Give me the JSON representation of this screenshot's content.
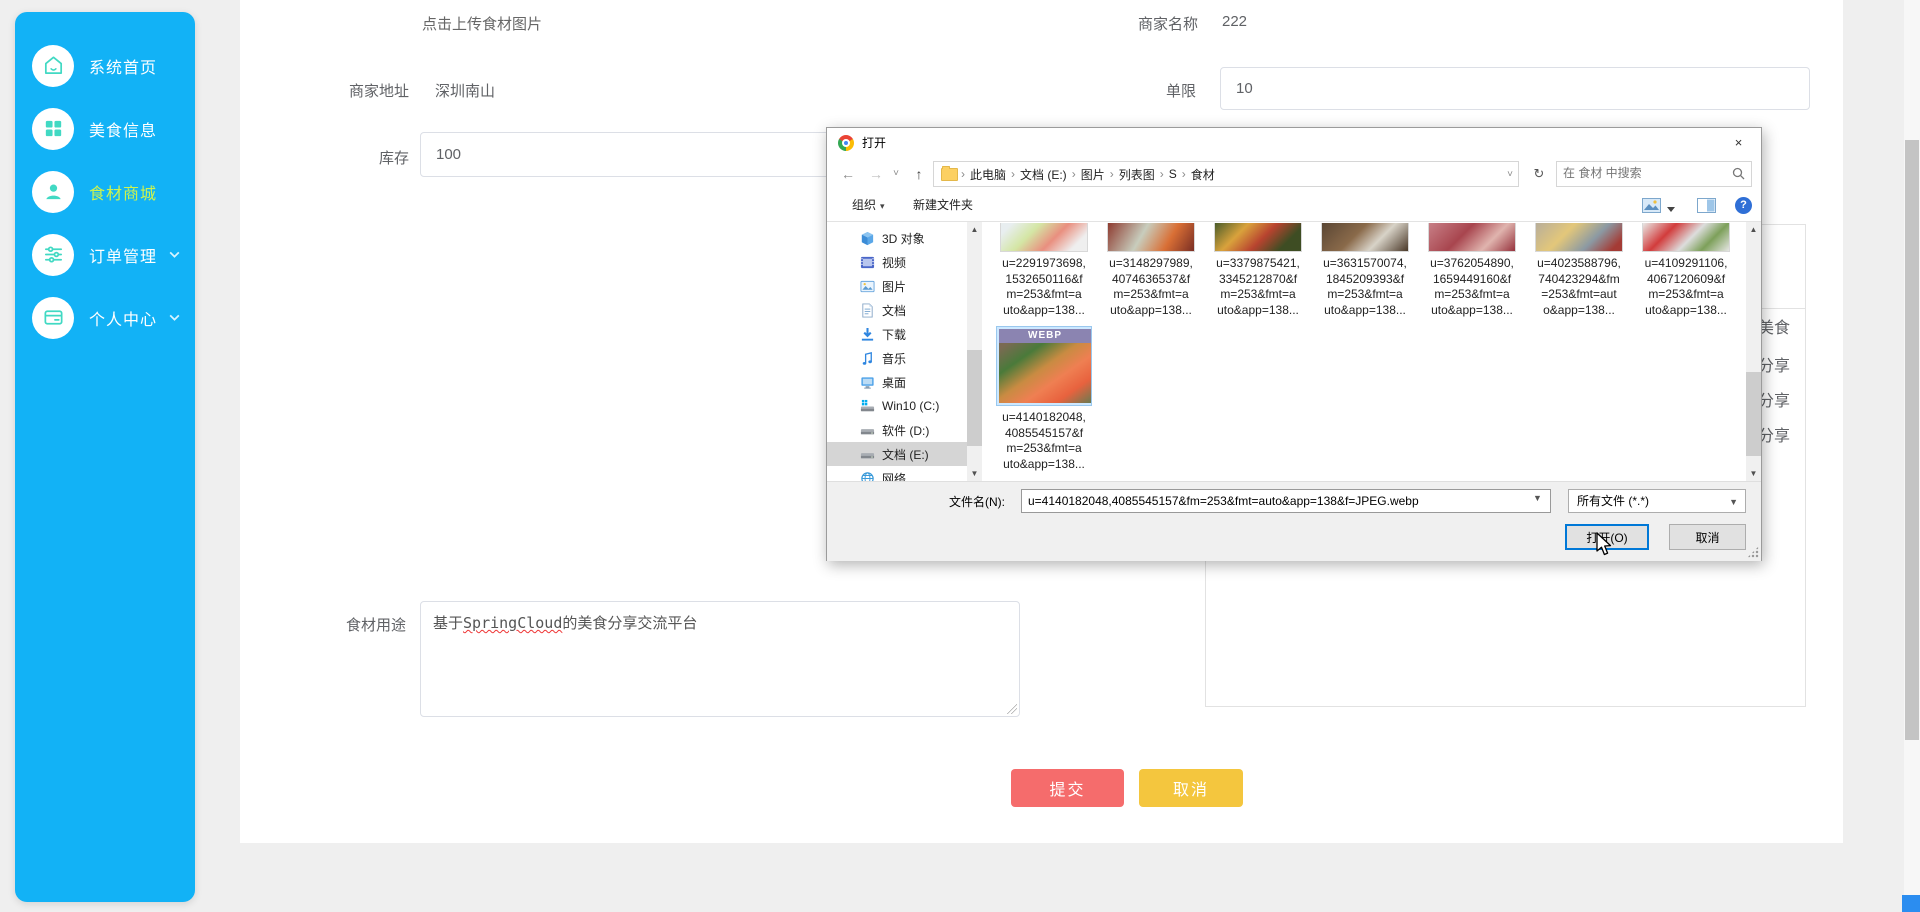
{
  "page": {
    "bg": "#efefef"
  },
  "sidebar": {
    "bg": "#12b2f6",
    "icon_color": "#41d9c3",
    "active_color": "#cdf34f",
    "items": [
      {
        "label": "系统首页",
        "icon": "home",
        "active": false,
        "chevron": false
      },
      {
        "label": "美食信息",
        "icon": "grid",
        "active": false,
        "chevron": false
      },
      {
        "label": "食材商城",
        "icon": "user",
        "active": true,
        "chevron": false
      },
      {
        "label": "订单管理",
        "icon": "sliders",
        "active": false,
        "chevron": true
      },
      {
        "label": "个人中心",
        "icon": "wallet",
        "active": false,
        "chevron": true
      }
    ]
  },
  "form": {
    "upload_hint": "点击上传食材图片",
    "fields": {
      "merchant_name": {
        "label": "商家名称",
        "value": "222"
      },
      "merchant_address": {
        "label": "商家地址",
        "value": "深圳南山"
      },
      "order_limit": {
        "label": "单限",
        "value": "10"
      },
      "stock": {
        "label": "库存",
        "value": "100"
      },
      "usage": {
        "label": "食材用途",
        "value_prefix": "基于",
        "value_misspelled": "SpringCloud",
        "value_suffix": "的美食分享交流平台"
      }
    },
    "right_panel_fragments": [
      "美食",
      "分享",
      "分享",
      "分享"
    ],
    "submit": {
      "label": "提交",
      "color": "#f56c6c"
    },
    "cancel": {
      "label": "取消",
      "color": "#f4c63e"
    }
  },
  "dialog": {
    "title": "打开",
    "close_glyph": "×",
    "nav": {
      "back": "←",
      "forward": "→",
      "dropdown": "˅",
      "up": "↑",
      "refresh": "↻"
    },
    "breadcrumb": [
      "此电脑",
      "文档 (E:)",
      "图片",
      "列表图",
      "S",
      "食材"
    ],
    "search_placeholder": "在 食材 中搜索",
    "toolbar": {
      "organize": "组织",
      "organize_caret": "▾",
      "new_folder": "新建文件夹",
      "help": "?"
    },
    "nav_pane": [
      {
        "label": "3D 对象",
        "icon": "cube"
      },
      {
        "label": "视频",
        "icon": "film"
      },
      {
        "label": "图片",
        "icon": "picture"
      },
      {
        "label": "文档",
        "icon": "doc"
      },
      {
        "label": "下载",
        "icon": "download"
      },
      {
        "label": "音乐",
        "icon": "music"
      },
      {
        "label": "桌面",
        "icon": "desktop"
      },
      {
        "label": "Win10 (C:)",
        "icon": "drive-win"
      },
      {
        "label": "软件 (D:)",
        "icon": "drive"
      },
      {
        "label": "文档 (E:)",
        "icon": "drive",
        "selected": true
      },
      {
        "label": "网络",
        "icon": "network",
        "partial": true
      }
    ],
    "files_row1": [
      {
        "name_lines": [
          "u=2291973698,",
          "1532650116&f",
          "m=253&fmt=a",
          "uto&app=138..."
        ]
      },
      {
        "name_lines": [
          "u=3148297989,",
          "4074636537&f",
          "m=253&fmt=a",
          "uto&app=138..."
        ]
      },
      {
        "name_lines": [
          "u=3379875421,",
          "3345212870&f",
          "m=253&fmt=a",
          "uto&app=138..."
        ]
      },
      {
        "name_lines": [
          "u=3631570074,",
          "1845209393&f",
          "m=253&fmt=a",
          "uto&app=138..."
        ]
      },
      {
        "name_lines": [
          "u=3762054890,",
          "1659449160&f",
          "m=253&fmt=a",
          "uto&app=138..."
        ]
      },
      {
        "name_lines": [
          "u=4023588796,",
          "740423294&fm",
          "=253&fmt=aut",
          "o&app=138..."
        ]
      },
      {
        "name_lines": [
          "u=4109291106,",
          "4067120609&f",
          "m=253&fmt=a",
          "uto&app=138..."
        ]
      }
    ],
    "selected_file": {
      "badge": "WEBP",
      "name_lines": [
        "u=4140182048,",
        "4085545157&f",
        "m=253&fmt=a",
        "uto&app=138..."
      ]
    },
    "filename_label": "文件名(N):",
    "filename_value": "u=4140182048,4085545157&fm=253&fmt=auto&app=138&f=JPEG.webp",
    "filetype_value": "所有文件 (*.*)",
    "open_button": "打开(O)",
    "cancel_button": "取消"
  }
}
